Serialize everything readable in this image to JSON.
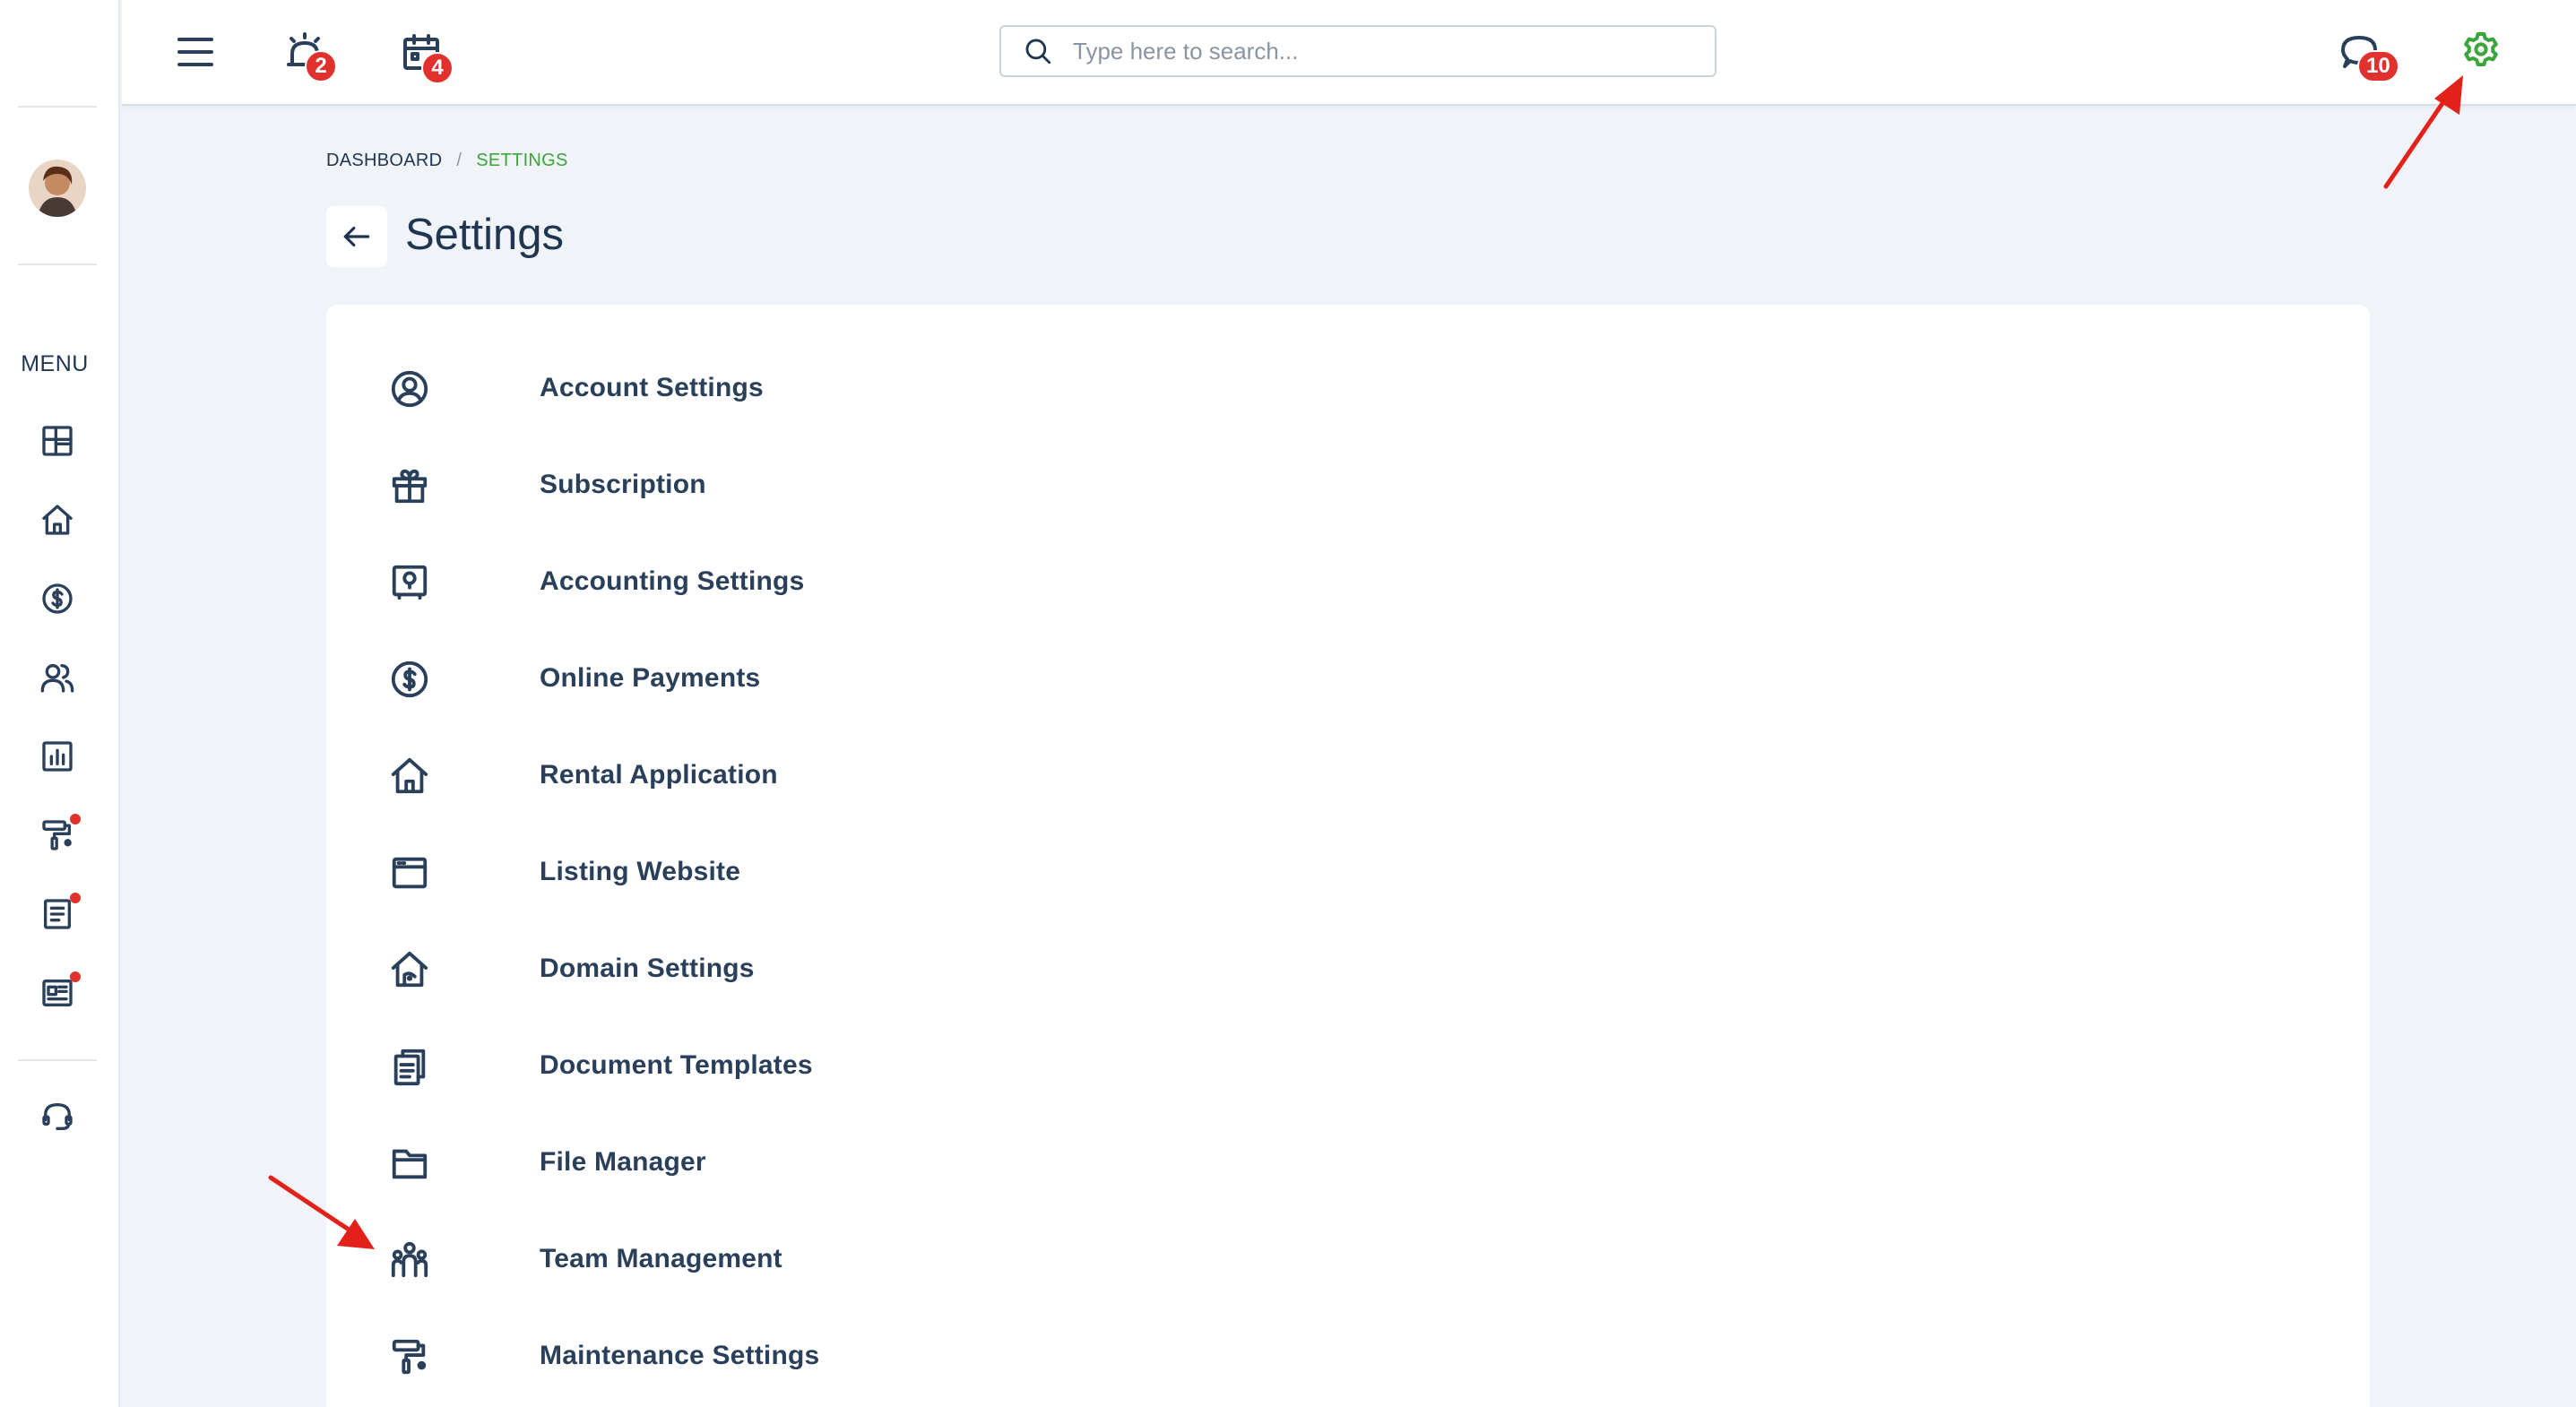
{
  "topbar": {
    "search_placeholder": "Type here to search...",
    "alerts_badge": "2",
    "calendar_badge": "4",
    "messages_badge": "10"
  },
  "sidebar": {
    "menu_label": "MENU"
  },
  "breadcrumb": {
    "root": "DASHBOARD",
    "separator": "/",
    "current": "SETTINGS"
  },
  "page": {
    "title": "Settings"
  },
  "settings_items": [
    {
      "label": "Account Settings",
      "icon": "user-circle-icon"
    },
    {
      "label": "Subscription",
      "icon": "gift-icon"
    },
    {
      "label": "Accounting Settings",
      "icon": "safe-icon"
    },
    {
      "label": "Online Payments",
      "icon": "dollar-circle-icon"
    },
    {
      "label": "Rental Application",
      "icon": "home-icon"
    },
    {
      "label": "Listing Website",
      "icon": "browser-window-icon"
    },
    {
      "label": "Domain Settings",
      "icon": "home-domain-icon"
    },
    {
      "label": "Document Templates",
      "icon": "documents-icon"
    },
    {
      "label": "File Manager",
      "icon": "folder-icon"
    },
    {
      "label": "Team Management",
      "icon": "team-icon"
    },
    {
      "label": "Maintenance Settings",
      "icon": "paint-roller-icon"
    }
  ],
  "colors": {
    "accent_green": "#3aa53a",
    "badge_red": "#e0312f",
    "text_navy": "#1f3550",
    "annotation_red": "#e3211b"
  }
}
